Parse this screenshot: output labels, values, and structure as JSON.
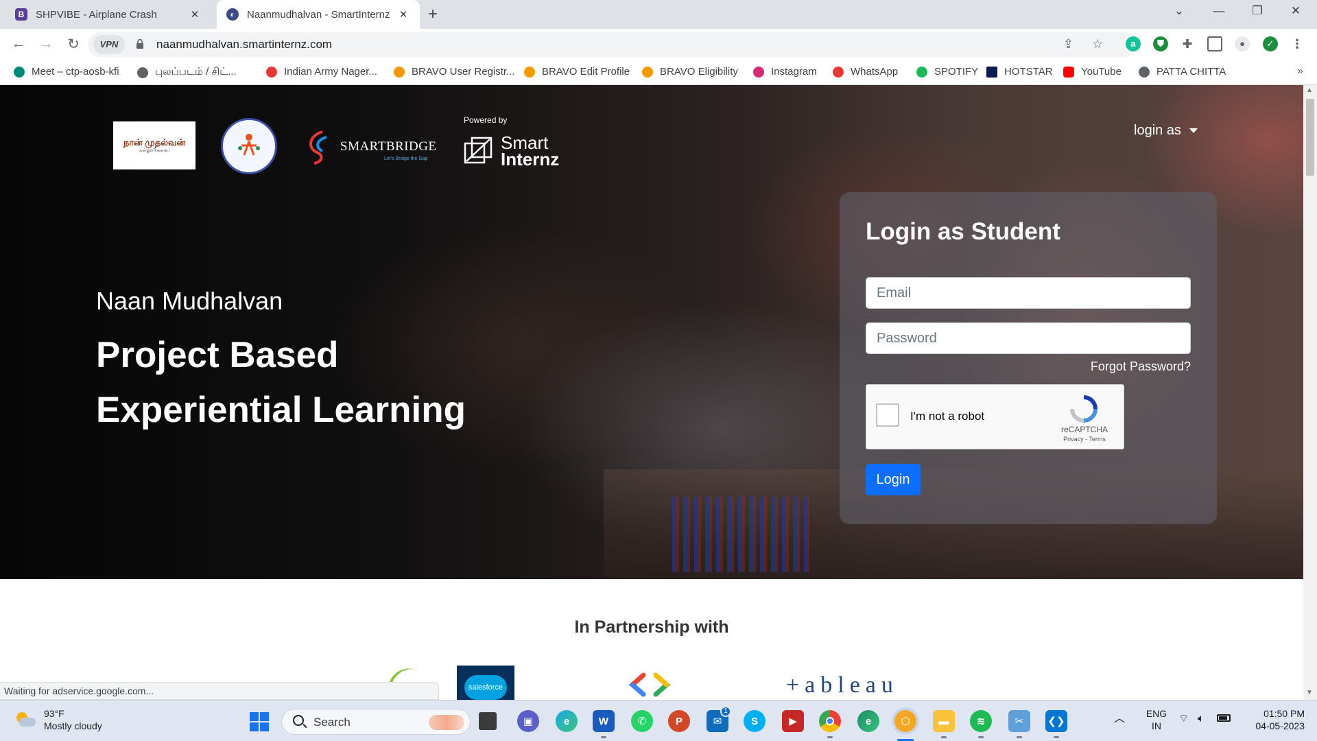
{
  "browser": {
    "tabs": [
      {
        "label": "SHPVIBE - Airplane Crash",
        "favicon": "B",
        "favicon_color": "#5b3e96"
      },
      {
        "label": "Naanmudhalvan - SmartInternz",
        "favicon": "globe",
        "favicon_color": "#3c4043"
      }
    ],
    "vpn_label": "VPN",
    "url": "naanmudhalvan.smartinternz.com",
    "bookmarks": [
      {
        "label": "Meet – ctp-aosb-kfi",
        "color": "#00897b"
      },
      {
        "label": "புலப்படம் / சிட்...",
        "color": "#5f6368"
      },
      {
        "label": "Indian Army Nager...",
        "color": "#e53935"
      },
      {
        "label": "BRAVO User Registr...",
        "color": "#f29900"
      },
      {
        "label": "BRAVO Edit Profile",
        "color": "#f29900"
      },
      {
        "label": "BRAVO Eligibility",
        "color": "#f29900"
      },
      {
        "label": "Instagram",
        "color": "#d62976"
      },
      {
        "label": "WhatsApp",
        "color": "#e53935"
      },
      {
        "label": "SPOTIFY",
        "color": "#1db954"
      },
      {
        "label": "HOTSTAR",
        "color": "#0c1b4d"
      },
      {
        "label": "YouTube",
        "color": "#ff0000"
      },
      {
        "label": "PATTA CHITTA",
        "color": "#5f6368"
      }
    ],
    "status_text": "Waiting for adservice.google.com..."
  },
  "page": {
    "logos": {
      "nm_tamil": "நான் முதல்வன்",
      "nm_sub": "கல்லூரி கனவு",
      "smartbridge": "SMARTBRIDGE",
      "smartbridge_tagline": "Let's Bridge the Gap",
      "powered_by": "Powered by",
      "smartinternz_line1": "Smart",
      "smartinternz_line2": "Internz"
    },
    "login_as": "login as",
    "hero_subtitle": "Naan Mudhalvan",
    "hero_title_line1": "Project Based",
    "hero_title_line2": "Experiential Learning",
    "login_card": {
      "title": "Login as Student",
      "email_placeholder": "Email",
      "password_placeholder": "Password",
      "forgot_password": "Forgot Password?",
      "captcha_label": "I'm not a robot",
      "captcha_brand": "reCAPTCHA",
      "captcha_terms": "Privacy - Terms",
      "login_button": "Login",
      "button_color": "#0d6efd"
    },
    "partners_heading": "In Partnership with",
    "partner_salesforce": "salesforce",
    "partner_tableau": "+ableau"
  },
  "taskbar": {
    "temperature": "93°F",
    "weather": "Mostly cloudy",
    "search_label": "Search",
    "language_line1": "ENG",
    "language_line2": "IN",
    "time": "01:50 PM",
    "date": "04-05-2023",
    "mail_badge": "1"
  }
}
